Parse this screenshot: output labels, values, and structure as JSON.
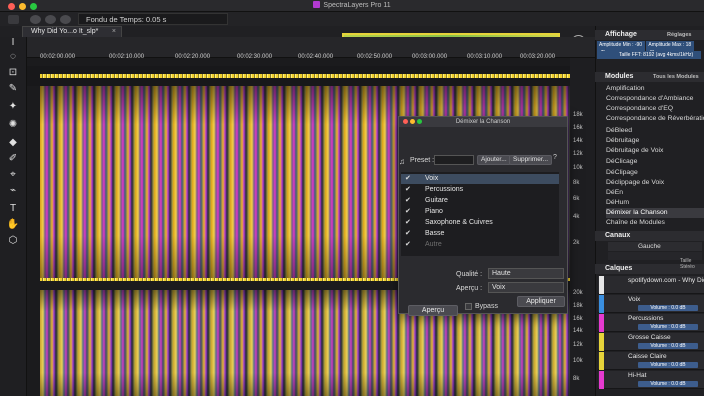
{
  "app": {
    "title": "SpectraLayers Pro 11"
  },
  "toolbar": {
    "fond_label": "Fondu de Temps: 0.05 s"
  },
  "tab": {
    "label": "Why Did Yo...o It_slp*",
    "close": "×"
  },
  "ruler": {
    "labels": [
      "00:02:00.000",
      "00:02:10.000",
      "00:02:20.000",
      "00:02:30.000",
      "00:02:40.000",
      "00:02:50.000",
      "00:03:00.000",
      "00:03:10.000",
      "00:03:20.000"
    ]
  },
  "freq": {
    "labels": [
      "18k",
      "16k",
      "14k",
      "12k",
      "10k",
      "8k",
      "6k",
      "4k",
      "2k",
      "20k",
      "18k",
      "16k",
      "14k",
      "12k",
      "10k",
      "8k"
    ]
  },
  "dialog": {
    "title": "Démixer la Chanson",
    "preset_label": "Preset :",
    "add_label": "Ajouter...",
    "delete_label": "Supprimer...",
    "help": "?",
    "stems": [
      {
        "label": "Voix",
        "checked": true
      },
      {
        "label": "Percussions",
        "checked": true
      },
      {
        "label": "Guitare",
        "checked": true
      },
      {
        "label": "Piano",
        "checked": true
      },
      {
        "label": "Saxophone & Cuivres",
        "checked": true
      },
      {
        "label": "Basse",
        "checked": true
      },
      {
        "label": "Autre",
        "checked": true
      }
    ],
    "quality_label": "Qualité :",
    "quality_value": "Haute",
    "preview_label": "Aperçu :",
    "preview_value": "Voix",
    "bypass_label": "Bypass",
    "preview_button": "Aperçu",
    "apply_button": "Appliquer"
  },
  "affichage": {
    "header": "Affichage",
    "preset": "Réglages Essentiels",
    "amp_min": "Amplitude Min : -90 dB",
    "amp_max": "Amplitude Max : 18 dB",
    "fft": "Taille FFT: 8192 (avg 4kms/1kHz)"
  },
  "modules": {
    "header": "Modules",
    "filter": "Tous les Modules",
    "items": [
      "Amplification",
      "Correspondance d'Ambiance",
      "Correspondance d'EQ",
      "Correspondance de Réverbération",
      "DéBleed",
      "Débruitage",
      "Débruitage de Voix",
      "DéClicage",
      "DéClipage",
      "Déclippage de Voix",
      "DéEn",
      "DéHum",
      "Démixer la Chanson",
      "Chaîne de Modules"
    ]
  },
  "canaux": {
    "header": "Canaux",
    "channel": "Gauche"
  },
  "calques": {
    "header": "Calques",
    "stack": "Taille Stéréo",
    "layers": [
      {
        "name": "spotifydown.com - Why Did Yo",
        "color": "#e6e6e6",
        "volume": ""
      },
      {
        "name": "Voix",
        "color": "#3a8fe0",
        "volume": "Volume : 0.0 dB"
      },
      {
        "name": "Percussions",
        "color": "#e63ad0",
        "volume": "Volume : 0.0 dB"
      },
      {
        "name": "Grosse Caisse",
        "color": "#e6d33a",
        "volume": "Volume : 0.0 dB"
      },
      {
        "name": "Caisse Claire",
        "color": "#e6d33a",
        "volume": "Volume : 0.0 dB"
      },
      {
        "name": "Hi-Hat",
        "color": "#e63ad0",
        "volume": "Volume : 0.0 dB"
      }
    ]
  }
}
